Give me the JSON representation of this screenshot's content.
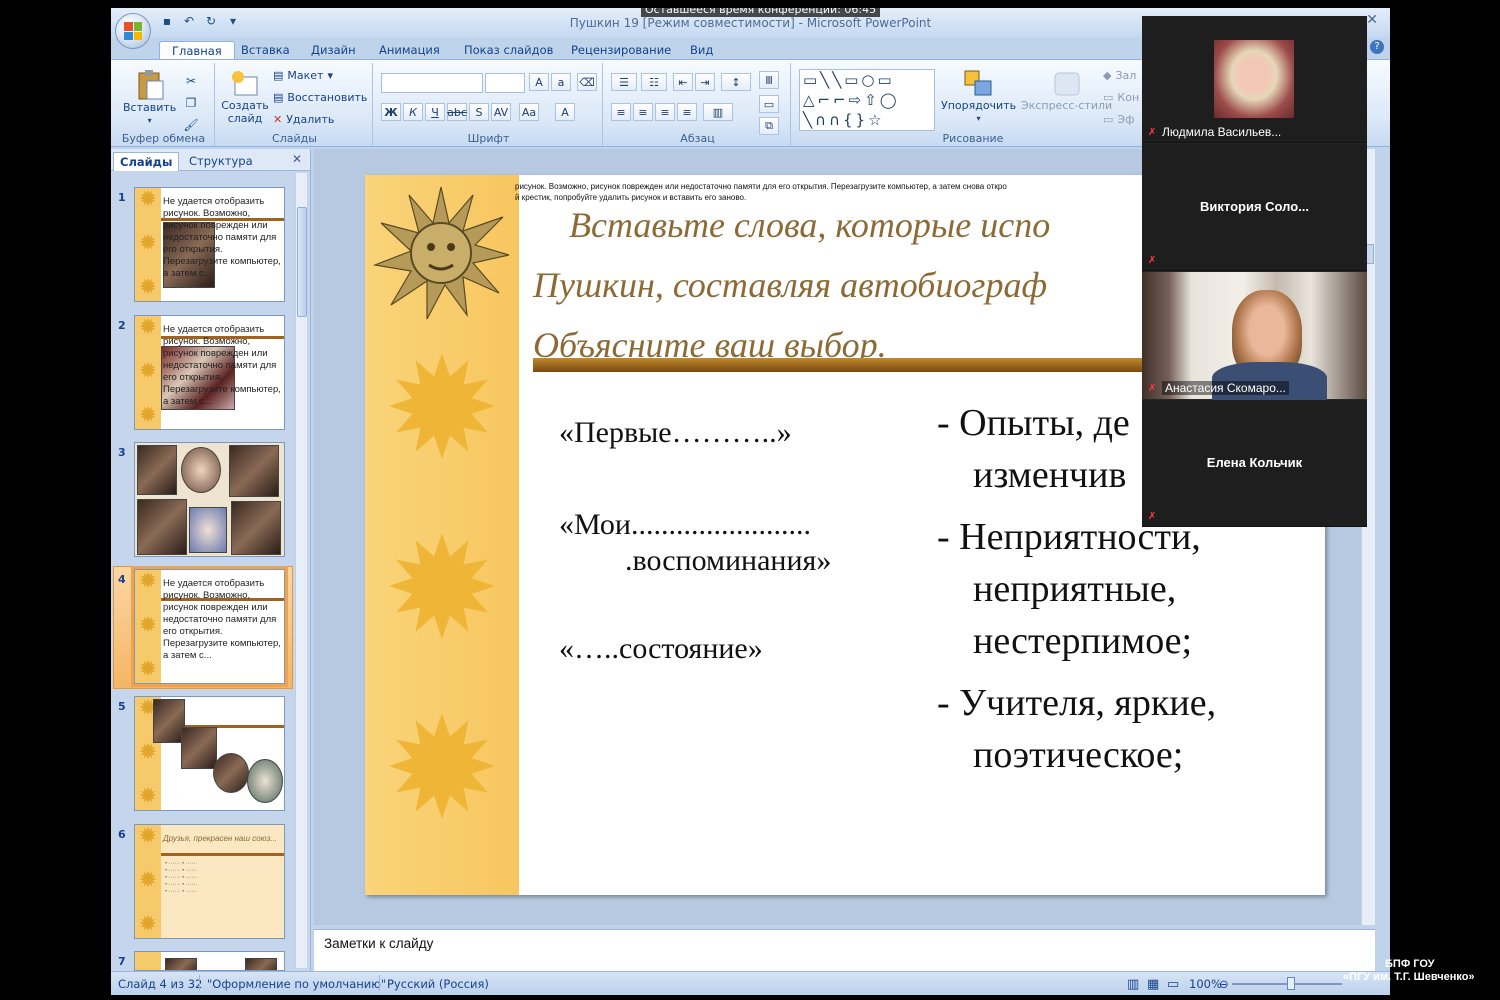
{
  "window": {
    "title": "Пушкин 19 [Режим совместимости] - Microsoft PowerPoint",
    "conference_time": "Оставшееся время конференции: 06:45"
  },
  "ribbon": {
    "tabs": [
      "Главная",
      "Вставка",
      "Дизайн",
      "Анимация",
      "Показ слайдов",
      "Рецензирование",
      "Вид"
    ],
    "groups": {
      "clipboard": {
        "label": "Буфер обмена",
        "paste": "Вставить"
      },
      "slides": {
        "label": "Слайды",
        "new_slide": "Создать слайд",
        "layout": "Макет",
        "reset": "Восстановить",
        "delete": "Удалить"
      },
      "font": {
        "label": "Шрифт"
      },
      "paragraph": {
        "label": "Абзац"
      },
      "drawing": {
        "label": "Рисование",
        "arrange": "Упорядочить",
        "quick_styles": "Экспресс-стили",
        "fill": "Зал",
        "outline": "Кон",
        "effects": "Эф"
      }
    }
  },
  "panel": {
    "tabs": [
      "Слайды",
      "Структура"
    ],
    "thumbs": [
      {
        "num": "1",
        "err": "Не удается отобразить рисунок. Возможно, рисунок поврежден или недостаточно памяти для его открытия. Перезагрузите компьютер, а затем с..."
      },
      {
        "num": "2",
        "err": "Не удается отобразить рисунок. Возможно, рисунок поврежден или недостаточно памяти для его открытия. Перезагрузите компьютер, а затем с..."
      },
      {
        "num": "3",
        "err": ""
      },
      {
        "num": "4",
        "err": "Не удается отобразить рисунок. Возможно, рисунок поврежден или недостаточно памяти для его открытия. Перезагрузите компьютер, а затем с..."
      },
      {
        "num": "5",
        "err": ""
      },
      {
        "num": "6",
        "err": "Друзья, прекрасен наш союз..."
      },
      {
        "num": "7",
        "err": ""
      }
    ]
  },
  "slide": {
    "error_text_line1": "рисунок. Возможно, рисунок поврежден или недостаточно памяти для его открытия. Перезагрузите компьютер, а затем снова откро",
    "error_text_line2": "й крестик, попробуйте удалить рисунок и вставить его заново.",
    "title_line1": "Вставьте слова, которые испо",
    "title_line2": "Пушкин,  составляя автобиограф",
    "title_line3": "Объясните ваш выбор.",
    "placeholders": [
      "«Первые………..»",
      "«Мои........................",
      ".воспоминания»",
      "«…..состояние»"
    ],
    "answers": [
      "- Опыты, де",
      "изменчив",
      "- Неприятности,",
      "неприятные,",
      "нестерпимое;",
      "- Учителя,  яркие,",
      "поэтическое;"
    ]
  },
  "notes": {
    "placeholder": "Заметки к слайду"
  },
  "status": {
    "slide": "Слайд 4 из 32",
    "theme": "\"Оформление по умолчанию\"",
    "language": "Русский (Россия)",
    "zoom": "100%"
  },
  "video": {
    "participants": [
      {
        "name": "Людмила Васильев..."
      },
      {
        "name": "Виктория   Соло..."
      },
      {
        "name": "Анастасия Скомаро..."
      },
      {
        "name": "Елена Кольчик"
      }
    ]
  },
  "watermark": {
    "line1": "БПФ ГОУ",
    "line2": "«ПГУ им. Т.Г. Шевченко»"
  },
  "colors": {
    "ribbon": "#dbe8f7",
    "strip": "#f7c65f",
    "title": "#8c6a36",
    "accent": "#f2a24a"
  }
}
